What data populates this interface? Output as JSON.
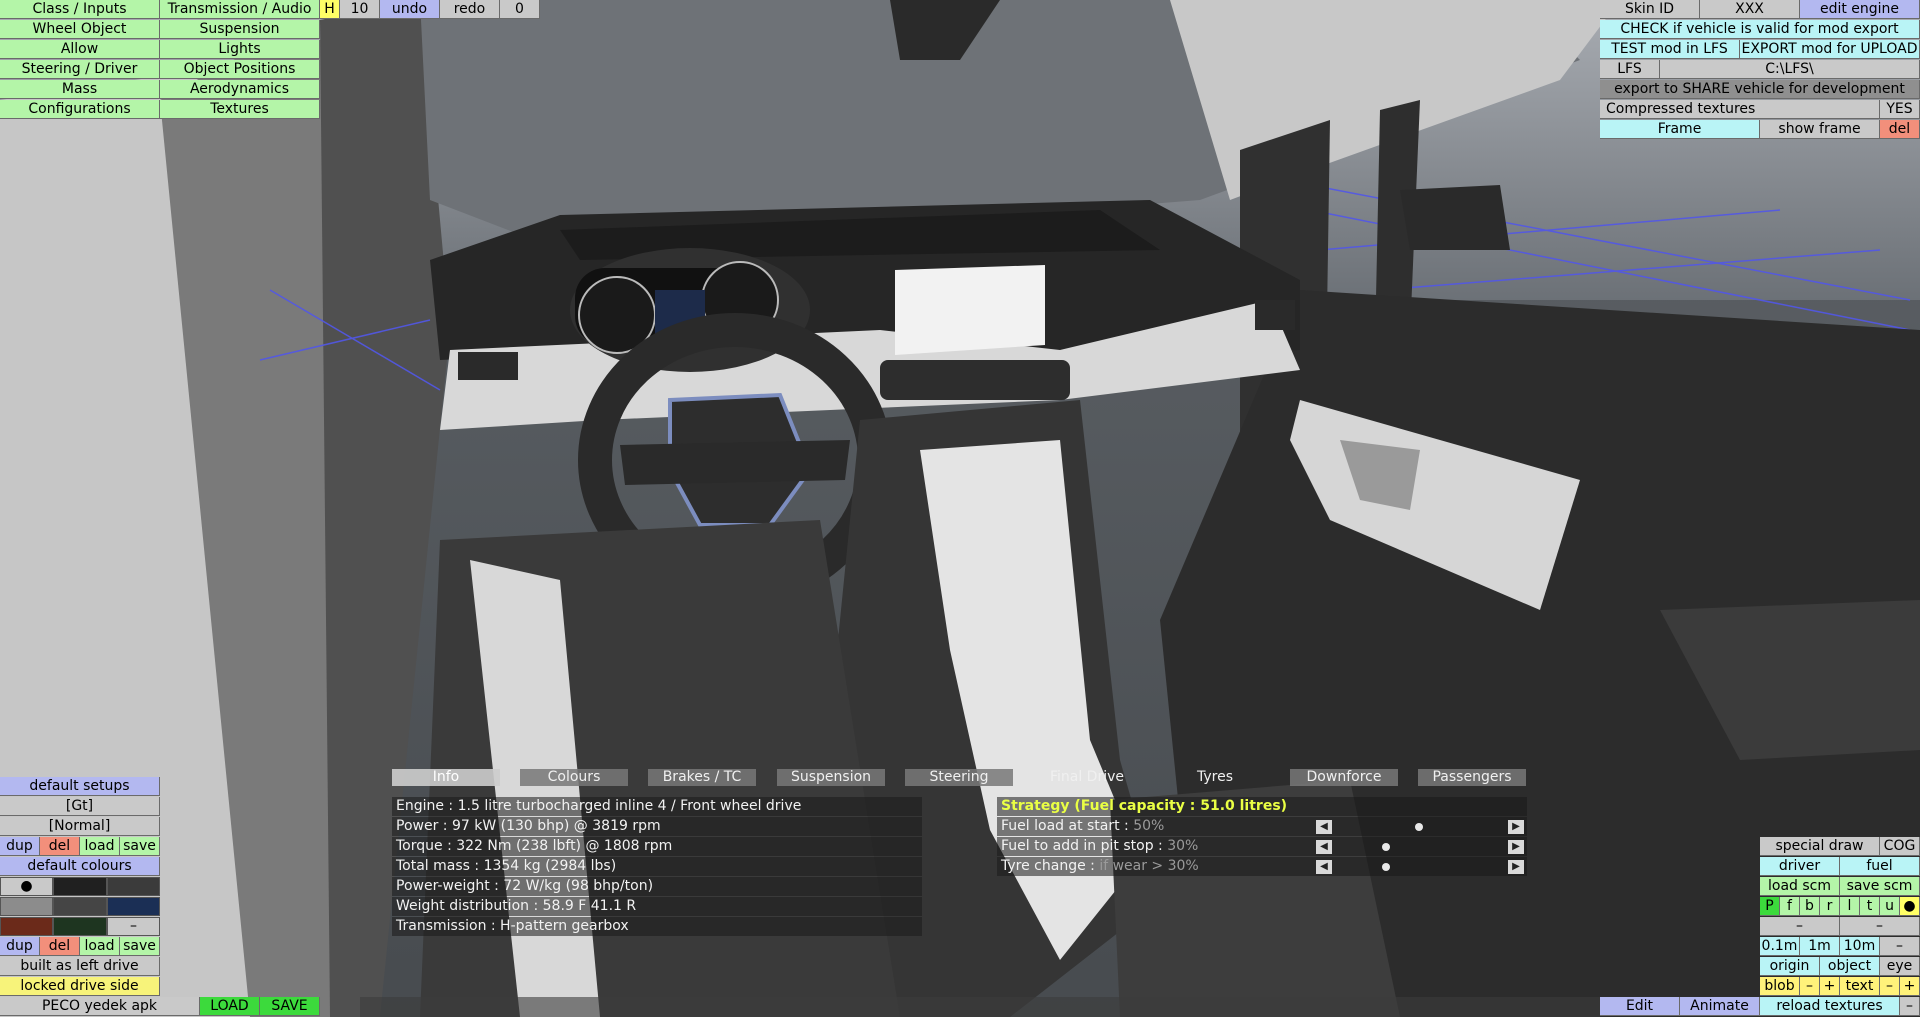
{
  "left_menu": {
    "col1": [
      "Class / Inputs",
      "Wheel Object",
      "Allow",
      "Steering / Driver",
      "Mass",
      "Configurations"
    ],
    "col2": [
      "Transmission / Audio",
      "Suspension",
      "Lights",
      "Object Positions",
      "Aerodynamics",
      "Textures"
    ]
  },
  "top_toolbar": {
    "h_label": "H",
    "h_value": "10",
    "undo_label": "undo",
    "redo_label": "redo",
    "redo_count": "0"
  },
  "top_right": {
    "skin_id_label": "Skin ID",
    "skin_id_value": "XXX",
    "edit_engine_label": "edit engine",
    "check_label": "CHECK if vehicle is valid for mod export",
    "test_label": "TEST mod in LFS",
    "export_upload_label": "EXPORT mod for UPLOAD",
    "lfs_label": "LFS",
    "lfs_path": "C:\\LFS\\",
    "export_share_label": "export to SHARE vehicle for development",
    "compressed_label": "Compressed textures",
    "compressed_value": "YES",
    "frame_label": "Frame",
    "show_frame_label": "show frame",
    "del_label": "del"
  },
  "info_panel": {
    "tabs": [
      "Info",
      "Colours",
      "Brakes / TC",
      "Suspension",
      "Steering",
      "Final Drive",
      "Tyres",
      "Downforce",
      "Passengers"
    ],
    "active_tab": "Info",
    "lines": [
      "Engine : 1.5 litre turbocharged inline 4 / Front wheel drive",
      "Power : 97 kW (130 bhp) @ 3819 rpm",
      "Torque : 322 Nm (238 lbft) @ 1808 rpm",
      "Total mass : 1354 kg (2984 lbs)",
      "Power-weight : 72 W/kg (98 bhp/ton)",
      "Weight distribution : 58.9 F  41.1 R",
      "Transmission : H-pattern gearbox"
    ],
    "strategy_title": "Strategy (Fuel capacity : 51.0 litres)",
    "strategy": [
      {
        "label": "Fuel load at start : ",
        "value": "50%",
        "fraction": 0.5
      },
      {
        "label": "Fuel to add in pit stop : ",
        "value": "30%",
        "fraction": 0.3
      },
      {
        "label": "Tyre change : ",
        "value": "if wear > 30%",
        "fraction": 0.3
      }
    ]
  },
  "bottom_left": {
    "default_setups_label": "default setups",
    "setup_gt": "[Gt]",
    "setup_normal": "[Normal]",
    "dup_label": "dup",
    "del_label": "del",
    "load_label": "load",
    "save_label": "save",
    "default_colours_label": "default colours",
    "swatch_marker": "●",
    "swatch_dash": "–",
    "swatch_colors": [
      "#c9c9c9",
      "#202020",
      "#3b3b3b",
      "#8c8c8c",
      "#454545",
      "#1b2f55",
      "#6b2a1a",
      "#1e3520",
      "#c9c9c9"
    ],
    "built_side_label": "built as left drive",
    "locked_label": "locked drive side",
    "vehicle_name": "PECO yedek apk",
    "load_button": "LOAD",
    "save_button": "SAVE"
  },
  "bottom_right": {
    "special_draw": "special draw",
    "cog": "COG",
    "driver": "driver",
    "fuel": "fuel",
    "load_scm": "load scm",
    "save_scm": "save scm",
    "toggles": [
      "P",
      "f",
      "b",
      "r",
      "l",
      "t",
      "u",
      "●"
    ],
    "dash": "–",
    "dist": [
      "0.1m",
      "1m",
      "10m",
      "–"
    ],
    "origin": "origin",
    "object": "object",
    "eye": "eye",
    "blob": "blob",
    "minus": "–",
    "plus": "+",
    "text": "text",
    "edit": "Edit",
    "animate": "Animate",
    "reload_textures": "reload textures"
  }
}
